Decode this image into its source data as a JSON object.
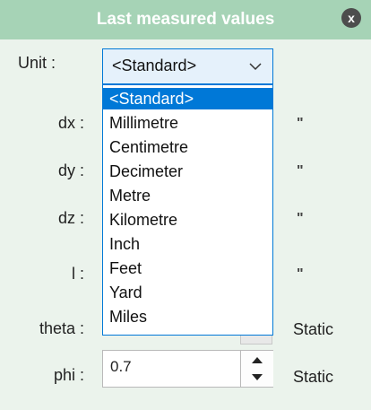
{
  "window": {
    "title": "Last measured values",
    "close_icon": "close-icon"
  },
  "unit": {
    "label": "Unit :",
    "selected": "<Standard>",
    "options": [
      "<Standard>",
      "Millimetre",
      "Centimetre",
      "Decimeter",
      "Metre",
      "Kilometre",
      "Inch",
      "Feet",
      "Yard",
      "Miles"
    ],
    "highlighted_index": 0
  },
  "fields": {
    "dx": {
      "label": "dx :",
      "unit": "\""
    },
    "dy": {
      "label": "dy :",
      "unit": "\""
    },
    "dz": {
      "label": "dz :",
      "unit": "\""
    },
    "l": {
      "label": "l :",
      "unit": "\""
    },
    "theta": {
      "label": "theta :",
      "unit": "Static"
    },
    "phi": {
      "label": "phi :",
      "value": "0.7",
      "unit": "Static"
    }
  },
  "colors": {
    "title_bar": "#a6d3b6",
    "panel": "#ebf3ec",
    "accent": "#0078d7"
  }
}
